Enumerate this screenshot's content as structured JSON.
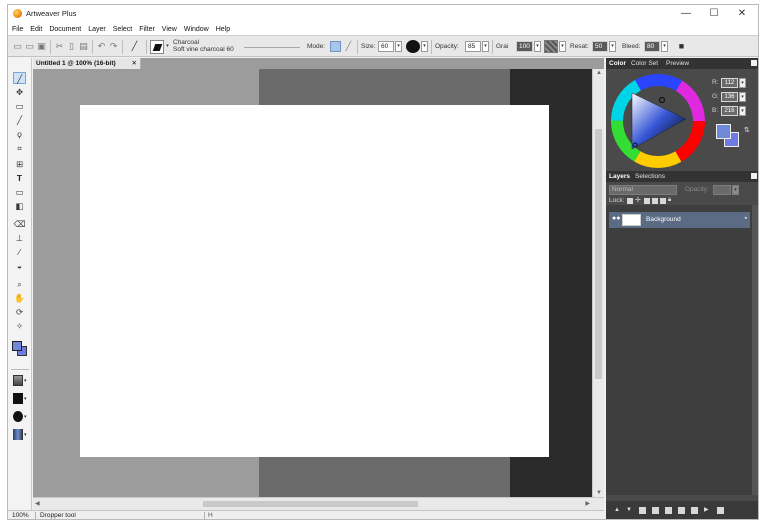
{
  "window": {
    "title": "Artweaver Plus",
    "controls": {
      "minimize": "—",
      "maximize": "☐",
      "close": "✕"
    }
  },
  "menu": [
    "File",
    "Edit",
    "Document",
    "Layer",
    "Select",
    "Filter",
    "View",
    "Window",
    "Help"
  ],
  "toolbar": {
    "brush_name": "Charcoal",
    "brush_variant": "Soft vine charcoal 60",
    "mode_label": "Mode:",
    "size_label": "Size:",
    "size_value": "60",
    "opacity_label": "Opacity:",
    "opacity_value": "85",
    "grain_label": "Grai",
    "grain_value": "100",
    "resat_label": "Resat:",
    "resat_value": "50",
    "bleed_label": "Bleed:",
    "bleed_value": "80"
  },
  "document": {
    "tab_title": "Untitled 1 @ 100% (16-bit)",
    "tab_close": "✕"
  },
  "statusbar": {
    "zoom": "100%",
    "tool": "Dropper tool"
  },
  "color_panel": {
    "tabs": [
      "Color",
      "Color Set",
      "Preview"
    ],
    "r_label": "R:",
    "r_value": "112",
    "g_label": "G:",
    "g_value": "136",
    "b_label": "B:",
    "b_value": "216",
    "primary_color": "#7088d8",
    "secondary_color": "#6f7be0"
  },
  "layers_panel": {
    "tabs": [
      "Layers",
      "Selections"
    ],
    "blend_mode": "Normal",
    "opacity_label": "Opacity:",
    "lock_label": "Lock:",
    "layers": [
      {
        "name": "Background"
      }
    ]
  }
}
